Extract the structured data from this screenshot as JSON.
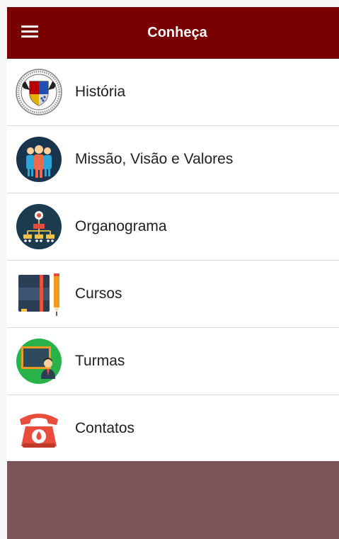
{
  "header": {
    "title": "Conheça",
    "background": "#790000"
  },
  "menu": {
    "items": [
      {
        "label": "História",
        "icon": "crest-icon"
      },
      {
        "label": "Missão, Visão e Valores",
        "icon": "team-icon"
      },
      {
        "label": "Organograma",
        "icon": "org-chart-icon"
      },
      {
        "label": "Cursos",
        "icon": "books-pencil-icon"
      },
      {
        "label": "Turmas",
        "icon": "classroom-icon"
      },
      {
        "label": "Contatos",
        "icon": "phone-icon"
      }
    ]
  },
  "footer": {
    "background": "#7a5458"
  }
}
